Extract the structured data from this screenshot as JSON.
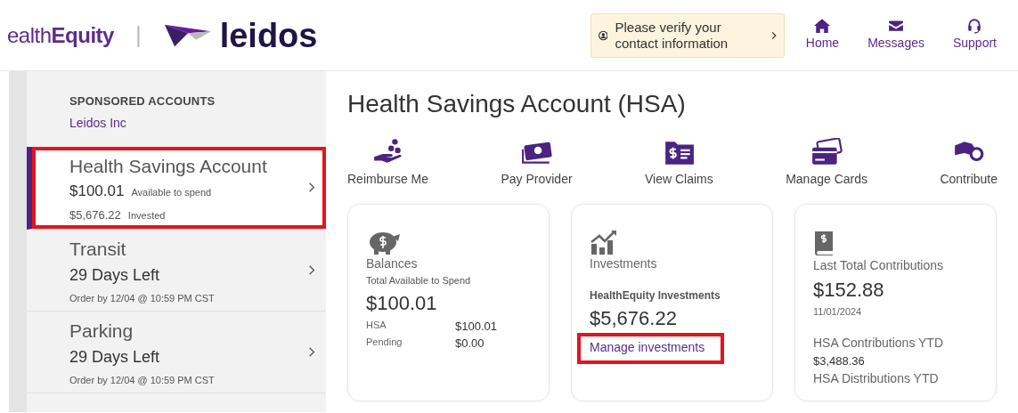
{
  "header": {
    "healthequity_logo": "ealth**Equity**",
    "separator": "|",
    "leidos_logo": "leidos"
  },
  "verify_banner": {
    "text": "Please verify your contact information"
  },
  "nav": [
    {
      "kind": "home",
      "label": "Home"
    },
    {
      "kind": "messages",
      "label": "Messages"
    },
    {
      "kind": "support",
      "label": "Support"
    }
  ],
  "sidebar": {
    "heading": "SPONSORED ACCOUNTS",
    "sponsor": "Leidos Inc",
    "items": [
      {
        "kind": "hsa",
        "title": "Health Savings Account",
        "amount": "$100.01",
        "amount_note": "Available to spend",
        "invested": "$5,676.22",
        "invested_note": "Invested",
        "selected": true,
        "highlighted": true
      },
      {
        "kind": "benefit",
        "title": "Transit",
        "days": "29 Days Left",
        "note": "Order by 12/04 @ 10:59 PM CST",
        "selected": false,
        "highlighted": false
      },
      {
        "kind": "benefit",
        "title": "Parking",
        "days": "29 Days Left",
        "note": "Order by 12/04 @ 10:59 PM CST",
        "selected": false,
        "highlighted": false
      }
    ]
  },
  "main": {
    "title": "Health Savings Account (HSA)",
    "actions": [
      {
        "kind": "reimburse",
        "label": "Reimburse Me"
      },
      {
        "kind": "pay",
        "label": "Pay Provider"
      },
      {
        "kind": "claims",
        "label": "View Claims"
      },
      {
        "kind": "cards",
        "label": "Manage Cards"
      },
      {
        "kind": "contribute",
        "label": "Contribute"
      }
    ],
    "cards": [
      {
        "kind": "balances",
        "title": "Balances",
        "subtitle": "Total Available to Spend",
        "amount": "$100.01",
        "rows": [
          {
            "label": "HSA",
            "value": "$100.01"
          },
          {
            "label": "Pending",
            "value": "$0.00"
          }
        ]
      },
      {
        "kind": "investments",
        "title": "Investments",
        "subtitle": "HealthEquity Investments",
        "amount": "$5,676.22",
        "link": "Manage investments",
        "link_highlighted": true
      },
      {
        "kind": "contributions",
        "title": "Last Total Contributions",
        "amount": "$152.88",
        "date": "11/01/2024",
        "stats": [
          {
            "label": "HSA Contributions YTD",
            "value": "$3,488.36"
          },
          {
            "label": "HSA Distributions YTD"
          }
        ]
      }
    ]
  }
}
